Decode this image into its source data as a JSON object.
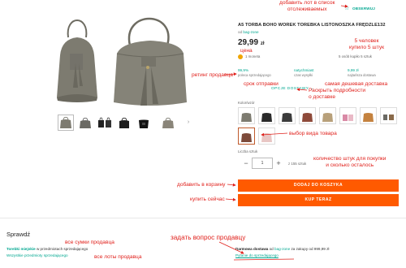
{
  "product": {
    "title": "A5 TORBA BOHO WOREK TOREBKA LISTONOSZKA FRĘDZLE132",
    "seller_prefix": "od",
    "seller_name": "bag-zone",
    "price_main": "29,99",
    "price_currency": "zł",
    "coins": "1 moneta",
    "bought": "5 osób kupiło 5 sztuk"
  },
  "header": {
    "observe_label": "OBSERWUJ"
  },
  "stats": [
    {
      "value": "99,9%",
      "label": "poleca sprzedającego"
    },
    {
      "value": "natychmiast",
      "label": "czas wysyłki"
    },
    {
      "value": "9,99 zł",
      "label": "najtańsza dostawa"
    }
  ],
  "delivery_options_label": "OPCJE DOSTAWY ⌄",
  "color_label": "Kolor/wzór",
  "quantity": {
    "label": "Liczba sztuk",
    "value": "1",
    "minus": "−",
    "plus": "+",
    "stock": "z 155 sztuk"
  },
  "buttons": {
    "add_to_cart": "DODAJ DO KOSZYKA",
    "buy_now": "KUP TERAZ"
  },
  "bottom": {
    "title": "Sprawdź",
    "link_bags_bold": "Torebki miejskie",
    "link_bags_rest": " w przedmiotach sprzedającego",
    "link_all": "Wszystkie przedmioty sprzedającego",
    "free_ship_bold": "Darmowa dostawa",
    "free_ship_from": " od ",
    "free_ship_seller": "bag-zone",
    "free_ship_rest": " za zakupy od 999,99 zł",
    "ask_link": "Pytanie do sprzedającego"
  },
  "annotations": {
    "add_to_watch": "добавить лот в список\nотслеживаемых",
    "price": "цена",
    "people_bought": "5 человек\nкупило 5 штук",
    "seller_rating": "ретинг продавца",
    "ship_time": "срок отправки",
    "cheapest": "самая дешевая доставка",
    "delivery_details": "Раскрыть подробности\nо доставке",
    "choose_type": "выбор вида товара",
    "qty_info": "количество штук для покупки\nи сколько осталось",
    "add_cart": "добавить в корзину",
    "buy_now": "купить сейчас",
    "ask_question": "задать вопрос продавцу",
    "all_bags": "все сумки продавца",
    "all_items": "все лоты продавца"
  },
  "colors": {
    "accent": "#ff5a00",
    "teal": "#00a790",
    "annotation": "#e0201b",
    "bag": "#7d7b70"
  }
}
